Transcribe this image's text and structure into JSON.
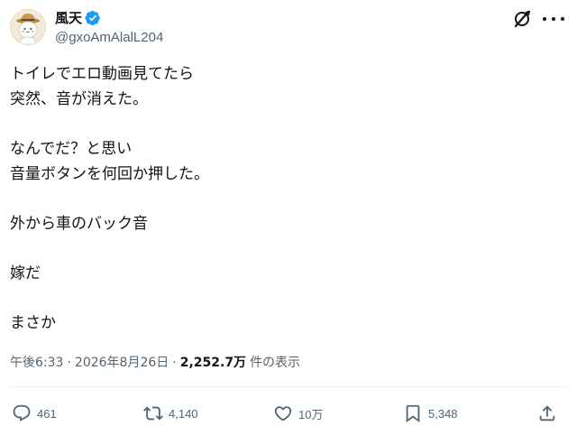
{
  "author": {
    "display_name": "風天",
    "handle": "@gxoAmAlalL204",
    "verified": true,
    "verified_color": "#1d9bf0"
  },
  "tweet": {
    "lines": [
      "トイレでエロ動画見てたら",
      "突然、音が消えた。",
      "",
      "なんでだ？と思い",
      "音量ボタンを何回か押した。",
      "",
      "外から車のバック音",
      "",
      "嫁だ",
      "",
      "まさか"
    ]
  },
  "meta": {
    "time": "午後6:33",
    "separator": "·",
    "date": "2026年8月26日",
    "views_count": "2,252.7万",
    "views_label": "件の表示"
  },
  "actions": {
    "replies": "461",
    "retweets": "4,140",
    "likes": "10万",
    "bookmarks": "5,348"
  },
  "icons": {
    "avatar": "avatar-illustration",
    "verified": "verified-badge-icon",
    "grok": "grok-icon",
    "more": "more-icon",
    "reply": "reply-icon",
    "retweet": "retweet-icon",
    "like": "heart-icon",
    "bookmark": "bookmark-icon",
    "share": "share-icon"
  }
}
